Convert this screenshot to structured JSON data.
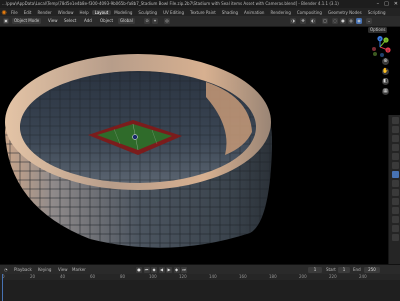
{
  "title_bar": {
    "text": "...\\ppw\\AppData\\Local\\Temp\\78d5e1e4b8e-f300-4093-9b065b-fa8b7_Stadium Bowl File.zip.2b7\\Stadium with Seal items Asset with Cameras.blend] - Blender 4.1.1 (3.1)",
    "minimize": "–",
    "maximize": "□",
    "close": "✕"
  },
  "menu": {
    "items": [
      "File",
      "Edit",
      "Render",
      "Window",
      "Help"
    ],
    "tabs": [
      "Layout",
      "Modeling",
      "Sculpting",
      "UV Editing",
      "Texture Paint",
      "Shading",
      "Animation",
      "Rendering",
      "Compositing",
      "Geometry Nodes",
      "Scripting"
    ],
    "active_tab": "Layout"
  },
  "header": {
    "mode": "Object Mode",
    "view": "View",
    "select": "Select",
    "add": "Add",
    "object": "Object",
    "orientation": "Global",
    "options": "Options"
  },
  "gizmo": {
    "x_label": "X",
    "y_label": "Y",
    "z_label": "Z",
    "colors": {
      "x": "#e0384b",
      "y": "#7ec02a",
      "z": "#3b7be0"
    }
  },
  "timeline": {
    "menus": [
      "Playback",
      "Keying",
      "View",
      "Marker"
    ],
    "current_frame": "1",
    "start_label": "Start",
    "start": "1",
    "end_label": "End",
    "end": "250",
    "ruler_ticks": [
      "0",
      "20",
      "40",
      "60",
      "80",
      "100",
      "120",
      "140",
      "160",
      "180",
      "200",
      "220",
      "240"
    ]
  }
}
